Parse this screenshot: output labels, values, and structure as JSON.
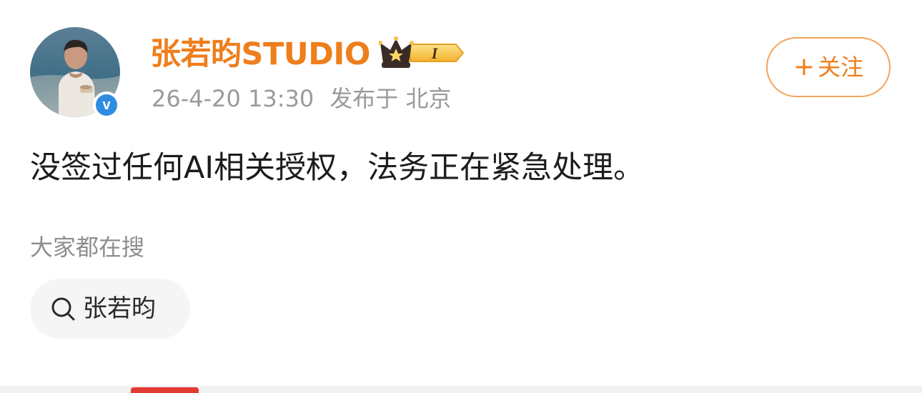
{
  "author": {
    "name": "张若昀STUDIO",
    "avatar_icon": "profile-photo",
    "verified_icon": "verified-v-icon",
    "verified_mark": "v",
    "vip_icon": "crown-vip-badge-icon",
    "vip_level": "I",
    "timestamp": "26-4-20 13:30",
    "published_from": "发布于 北京"
  },
  "follow_button": {
    "plus": "+",
    "label": "关注"
  },
  "post": {
    "text": "没签过任何AI相关授权，法务正在紧急处理。"
  },
  "trending": {
    "title": "大家都在搜",
    "search_icon": "search-icon",
    "items": [
      {
        "label": "张若昀"
      }
    ]
  },
  "colors": {
    "brand_orange": "#ef7e1c",
    "follow_border": "#f3a55a",
    "verified_blue": "#2e8de3",
    "meta_gray": "#9a9a9a",
    "chip_bg": "#f5f5f5",
    "accent_red": "#e23a33"
  }
}
